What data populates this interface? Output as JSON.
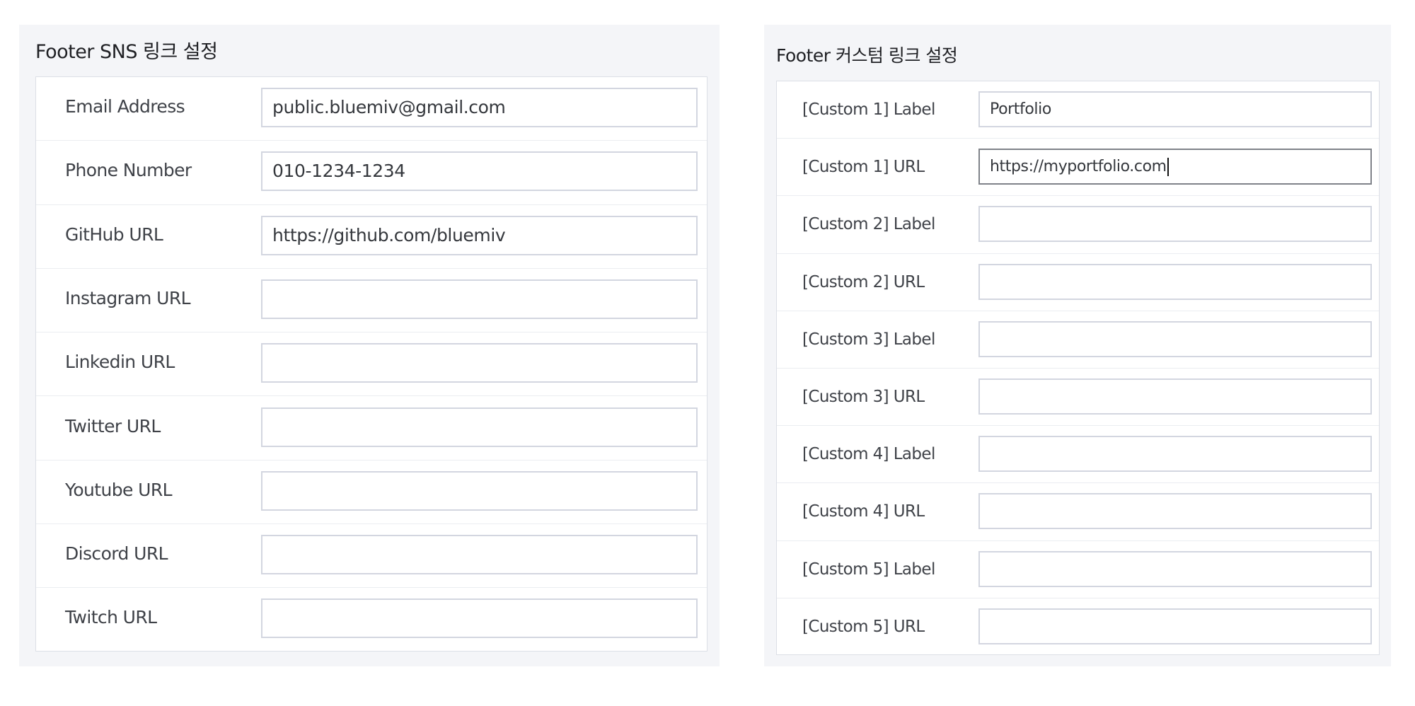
{
  "sns": {
    "title": "Footer SNS 링크 설정",
    "rows": [
      {
        "label": "Email Address",
        "value": "public.bluemiv@gmail.com"
      },
      {
        "label": "Phone Number",
        "value": "010-1234-1234"
      },
      {
        "label": "GitHub URL",
        "value": "https://github.com/bluemiv"
      },
      {
        "label": "Instagram URL",
        "value": ""
      },
      {
        "label": "Linkedin URL",
        "value": ""
      },
      {
        "label": "Twitter URL",
        "value": ""
      },
      {
        "label": "Youtube URL",
        "value": ""
      },
      {
        "label": "Discord URL",
        "value": ""
      },
      {
        "label": "Twitch URL",
        "value": ""
      }
    ]
  },
  "custom": {
    "title": "Footer 커스텀 링크 설정",
    "rows": [
      {
        "label": "[Custom 1] Label",
        "value": "Portfolio"
      },
      {
        "label": "[Custom 1] URL",
        "value": "https://myportfolio.com"
      },
      {
        "label": "[Custom 2] Label",
        "value": ""
      },
      {
        "label": "[Custom 2] URL",
        "value": ""
      },
      {
        "label": "[Custom 3] Label",
        "value": ""
      },
      {
        "label": "[Custom 3] URL",
        "value": ""
      },
      {
        "label": "[Custom 4] Label",
        "value": ""
      },
      {
        "label": "[Custom 4] URL",
        "value": ""
      },
      {
        "label": "[Custom 5] Label",
        "value": ""
      },
      {
        "label": "[Custom 5] URL",
        "value": ""
      }
    ]
  }
}
